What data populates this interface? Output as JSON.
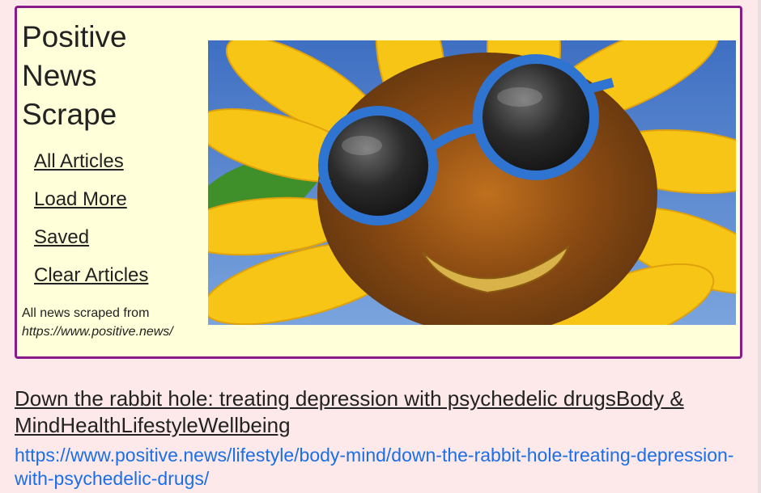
{
  "header": {
    "title_lines": [
      "Positive",
      "News",
      "Scrape"
    ],
    "nav": [
      {
        "label": "All Articles"
      },
      {
        "label": "Load More"
      },
      {
        "label": "Saved"
      },
      {
        "label": "Clear Articles"
      }
    ],
    "credit_text": "All news scraped from",
    "credit_url": "https://www.positive.news/",
    "border_color": "#8b1a8b",
    "background_color": "#ffffd9"
  },
  "hero_image": {
    "icon": "sunflower-with-sunglasses-image"
  },
  "article": {
    "title": "Down the rabbit hole: treating depression with psychedelic drugsBody & MindHealthLifestyleWellbeing",
    "url": "https://www.positive.news/lifestyle/body-mind/down-the-rabbit-hole-treating-depression-with-psychedelic-drugs/",
    "link_color": "#1a6fe8"
  },
  "page_background": "#fde9e9"
}
